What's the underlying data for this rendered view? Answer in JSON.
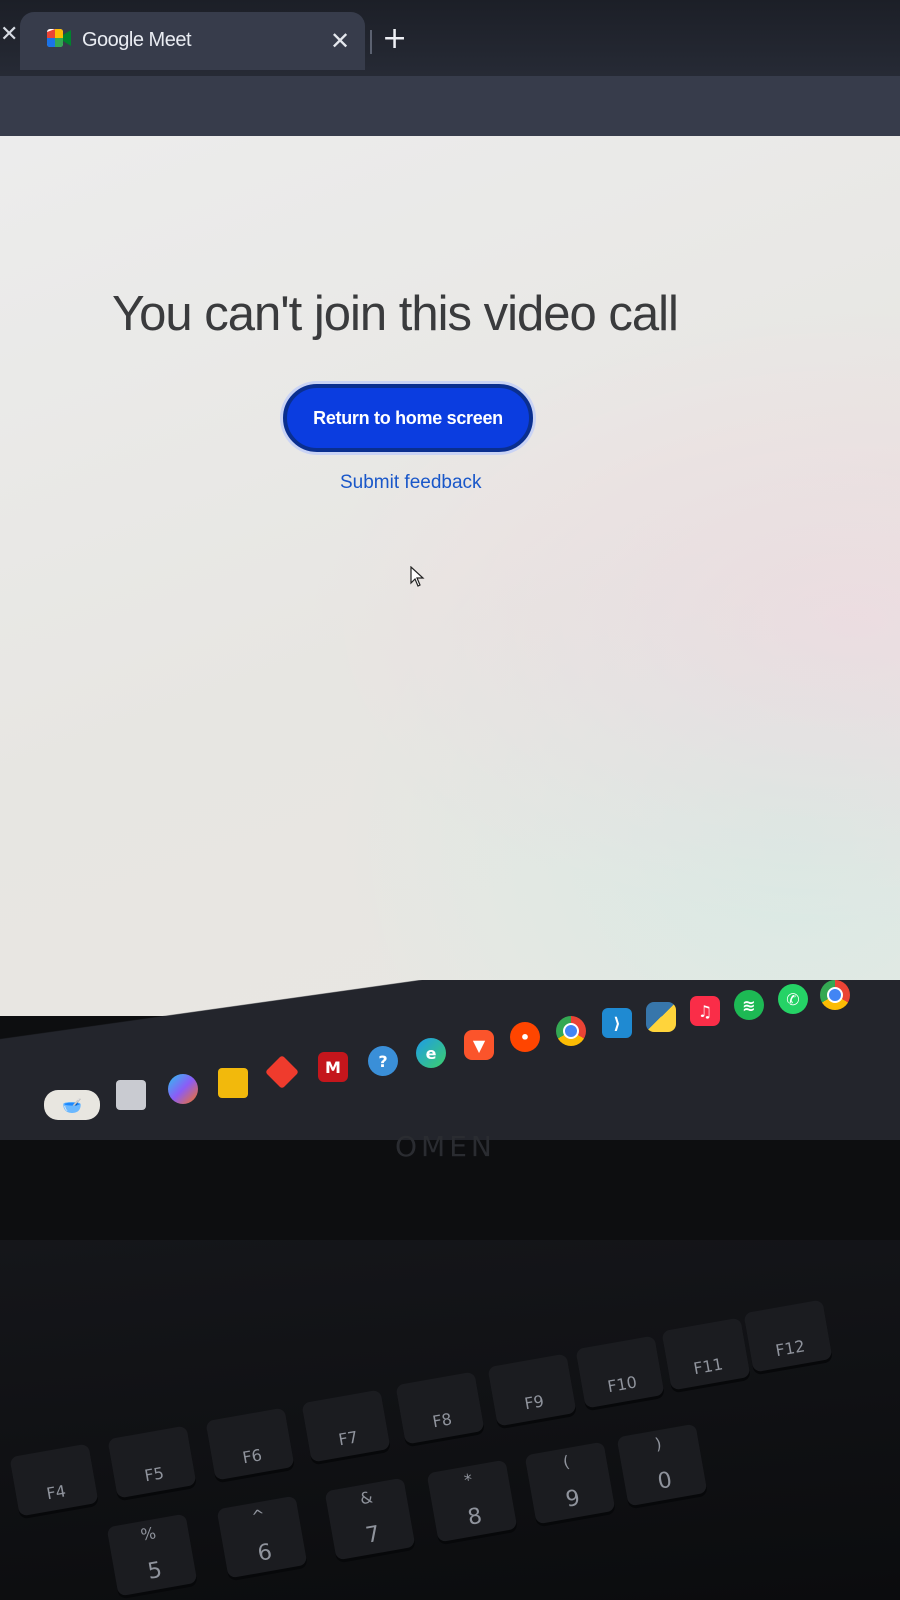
{
  "browser": {
    "tab_title": "Google Meet",
    "close_glyph": "✕",
    "new_tab_glyph": "+",
    "left_close_glyph": "✕"
  },
  "page": {
    "headline": "You can't join this video call",
    "return_button_label": "Return to home screen",
    "feedback_link_label": "Submit feedback"
  },
  "colors": {
    "primary_button": "#0b3de0",
    "link": "#1957c9",
    "tab_bar": "#262a35",
    "active_tab": "#373c4b"
  },
  "taskbar": {
    "icons": [
      "weather-widget-icon",
      "task-view-icon",
      "copilot-icon",
      "file-explorer-icon",
      "app-diamond-icon",
      "mcafee-icon",
      "help-icon",
      "edge-icon",
      "brave-icon",
      "reddit-icon",
      "chrome-icon",
      "vscode-icon",
      "python-icon",
      "apple-music-icon",
      "spotify-icon",
      "whatsapp-icon",
      "chrome-profile-icon"
    ]
  },
  "laptop": {
    "brand_logo": "OMEN",
    "fn_keys": [
      "F4",
      "F5",
      "F6",
      "F7",
      "F8",
      "F9",
      "F10",
      "F11",
      "F12"
    ],
    "number_keys": [
      "5",
      "6",
      "7",
      "8",
      "9",
      "0"
    ],
    "number_key_symbols": [
      "%",
      "^",
      "&",
      "*",
      "(",
      ")"
    ]
  }
}
